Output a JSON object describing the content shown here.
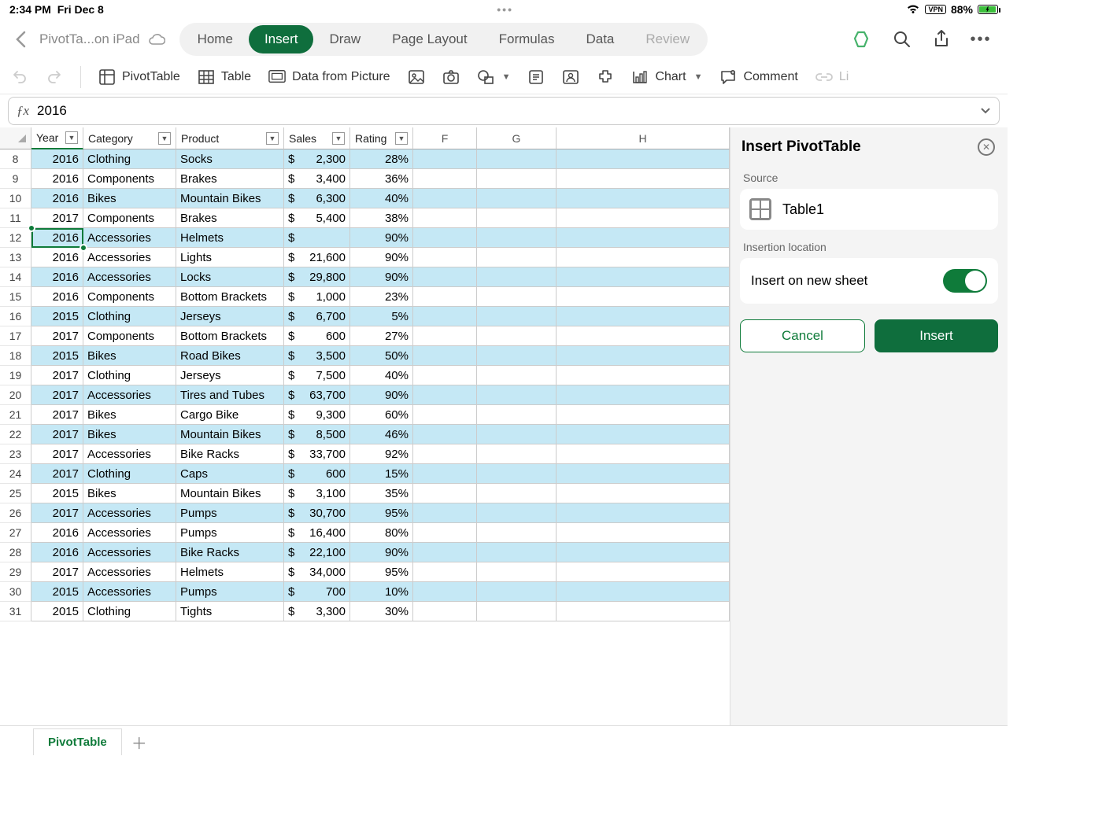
{
  "status": {
    "time": "2:34 PM",
    "date": "Fri Dec 8",
    "vpn": "VPN",
    "battery": "88%"
  },
  "doc": {
    "title": "PivotTa...on iPad"
  },
  "ribbon_tabs": {
    "home": "Home",
    "insert": "Insert",
    "draw": "Draw",
    "pagelayout": "Page Layout",
    "formulas": "Formulas",
    "data": "Data",
    "review": "Review"
  },
  "ribbon": {
    "pivottable": "PivotTable",
    "table": "Table",
    "datapic": "Data from Picture",
    "chart": "Chart",
    "comment": "Comment",
    "link": "Li"
  },
  "formula": {
    "value": "2016"
  },
  "columns": {
    "year": "Year",
    "category": "Category",
    "product": "Product",
    "sales": "Sales",
    "rating": "Rating",
    "f": "F",
    "g": "G",
    "h": "H"
  },
  "rows": [
    {
      "n": 8,
      "year": "2016",
      "category": "Clothing",
      "product": "Socks",
      "sales": "2,300",
      "rating": "28%",
      "band": true
    },
    {
      "n": 9,
      "year": "2016",
      "category": "Components",
      "product": "Brakes",
      "sales": "3,400",
      "rating": "36%",
      "band": false
    },
    {
      "n": 10,
      "year": "2016",
      "category": "Bikes",
      "product": "Mountain Bikes",
      "sales": "6,300",
      "rating": "40%",
      "band": true
    },
    {
      "n": 11,
      "year": "2017",
      "category": "Components",
      "product": "Brakes",
      "sales": "5,400",
      "rating": "38%",
      "band": false
    },
    {
      "n": 12,
      "year": "2016",
      "category": "Accessories",
      "product": "Helmets",
      "sales": "",
      "rating": "90%",
      "band": true,
      "selected": true
    },
    {
      "n": 13,
      "year": "2016",
      "category": "Accessories",
      "product": "Lights",
      "sales": "21,600",
      "rating": "90%",
      "band": false
    },
    {
      "n": 14,
      "year": "2016",
      "category": "Accessories",
      "product": "Locks",
      "sales": "29,800",
      "rating": "90%",
      "band": true
    },
    {
      "n": 15,
      "year": "2016",
      "category": "Components",
      "product": "Bottom Brackets",
      "sales": "1,000",
      "rating": "23%",
      "band": false
    },
    {
      "n": 16,
      "year": "2015",
      "category": "Clothing",
      "product": "Jerseys",
      "sales": "6,700",
      "rating": "5%",
      "band": true
    },
    {
      "n": 17,
      "year": "2017",
      "category": "Components",
      "product": "Bottom Brackets",
      "sales": "600",
      "rating": "27%",
      "band": false
    },
    {
      "n": 18,
      "year": "2015",
      "category": "Bikes",
      "product": "Road Bikes",
      "sales": "3,500",
      "rating": "50%",
      "band": true
    },
    {
      "n": 19,
      "year": "2017",
      "category": "Clothing",
      "product": "Jerseys",
      "sales": "7,500",
      "rating": "40%",
      "band": false
    },
    {
      "n": 20,
      "year": "2017",
      "category": "Accessories",
      "product": "Tires and Tubes",
      "sales": "63,700",
      "rating": "90%",
      "band": true
    },
    {
      "n": 21,
      "year": "2017",
      "category": "Bikes",
      "product": "Cargo Bike",
      "sales": "9,300",
      "rating": "60%",
      "band": false
    },
    {
      "n": 22,
      "year": "2017",
      "category": "Bikes",
      "product": "Mountain Bikes",
      "sales": "8,500",
      "rating": "46%",
      "band": true
    },
    {
      "n": 23,
      "year": "2017",
      "category": "Accessories",
      "product": "Bike Racks",
      "sales": "33,700",
      "rating": "92%",
      "band": false
    },
    {
      "n": 24,
      "year": "2017",
      "category": "Clothing",
      "product": "Caps",
      "sales": "600",
      "rating": "15%",
      "band": true
    },
    {
      "n": 25,
      "year": "2015",
      "category": "Bikes",
      "product": "Mountain Bikes",
      "sales": "3,100",
      "rating": "35%",
      "band": false
    },
    {
      "n": 26,
      "year": "2017",
      "category": "Accessories",
      "product": "Pumps",
      "sales": "30,700",
      "rating": "95%",
      "band": true
    },
    {
      "n": 27,
      "year": "2016",
      "category": "Accessories",
      "product": "Pumps",
      "sales": "16,400",
      "rating": "80%",
      "band": false
    },
    {
      "n": 28,
      "year": "2016",
      "category": "Accessories",
      "product": "Bike Racks",
      "sales": "22,100",
      "rating": "90%",
      "band": true
    },
    {
      "n": 29,
      "year": "2017",
      "category": "Accessories",
      "product": "Helmets",
      "sales": "34,000",
      "rating": "95%",
      "band": false
    },
    {
      "n": 30,
      "year": "2015",
      "category": "Accessories",
      "product": "Pumps",
      "sales": "700",
      "rating": "10%",
      "band": true
    },
    {
      "n": 31,
      "year": "2015",
      "category": "Clothing",
      "product": "Tights",
      "sales": "3,300",
      "rating": "30%",
      "band": false
    }
  ],
  "panel": {
    "title": "Insert PivotTable",
    "source_label": "Source",
    "source_name": "Table1",
    "location_label": "Insertion location",
    "insert_new_sheet": "Insert on new sheet",
    "cancel": "Cancel",
    "insert": "Insert"
  },
  "sheet": {
    "tab": "PivotTable"
  }
}
